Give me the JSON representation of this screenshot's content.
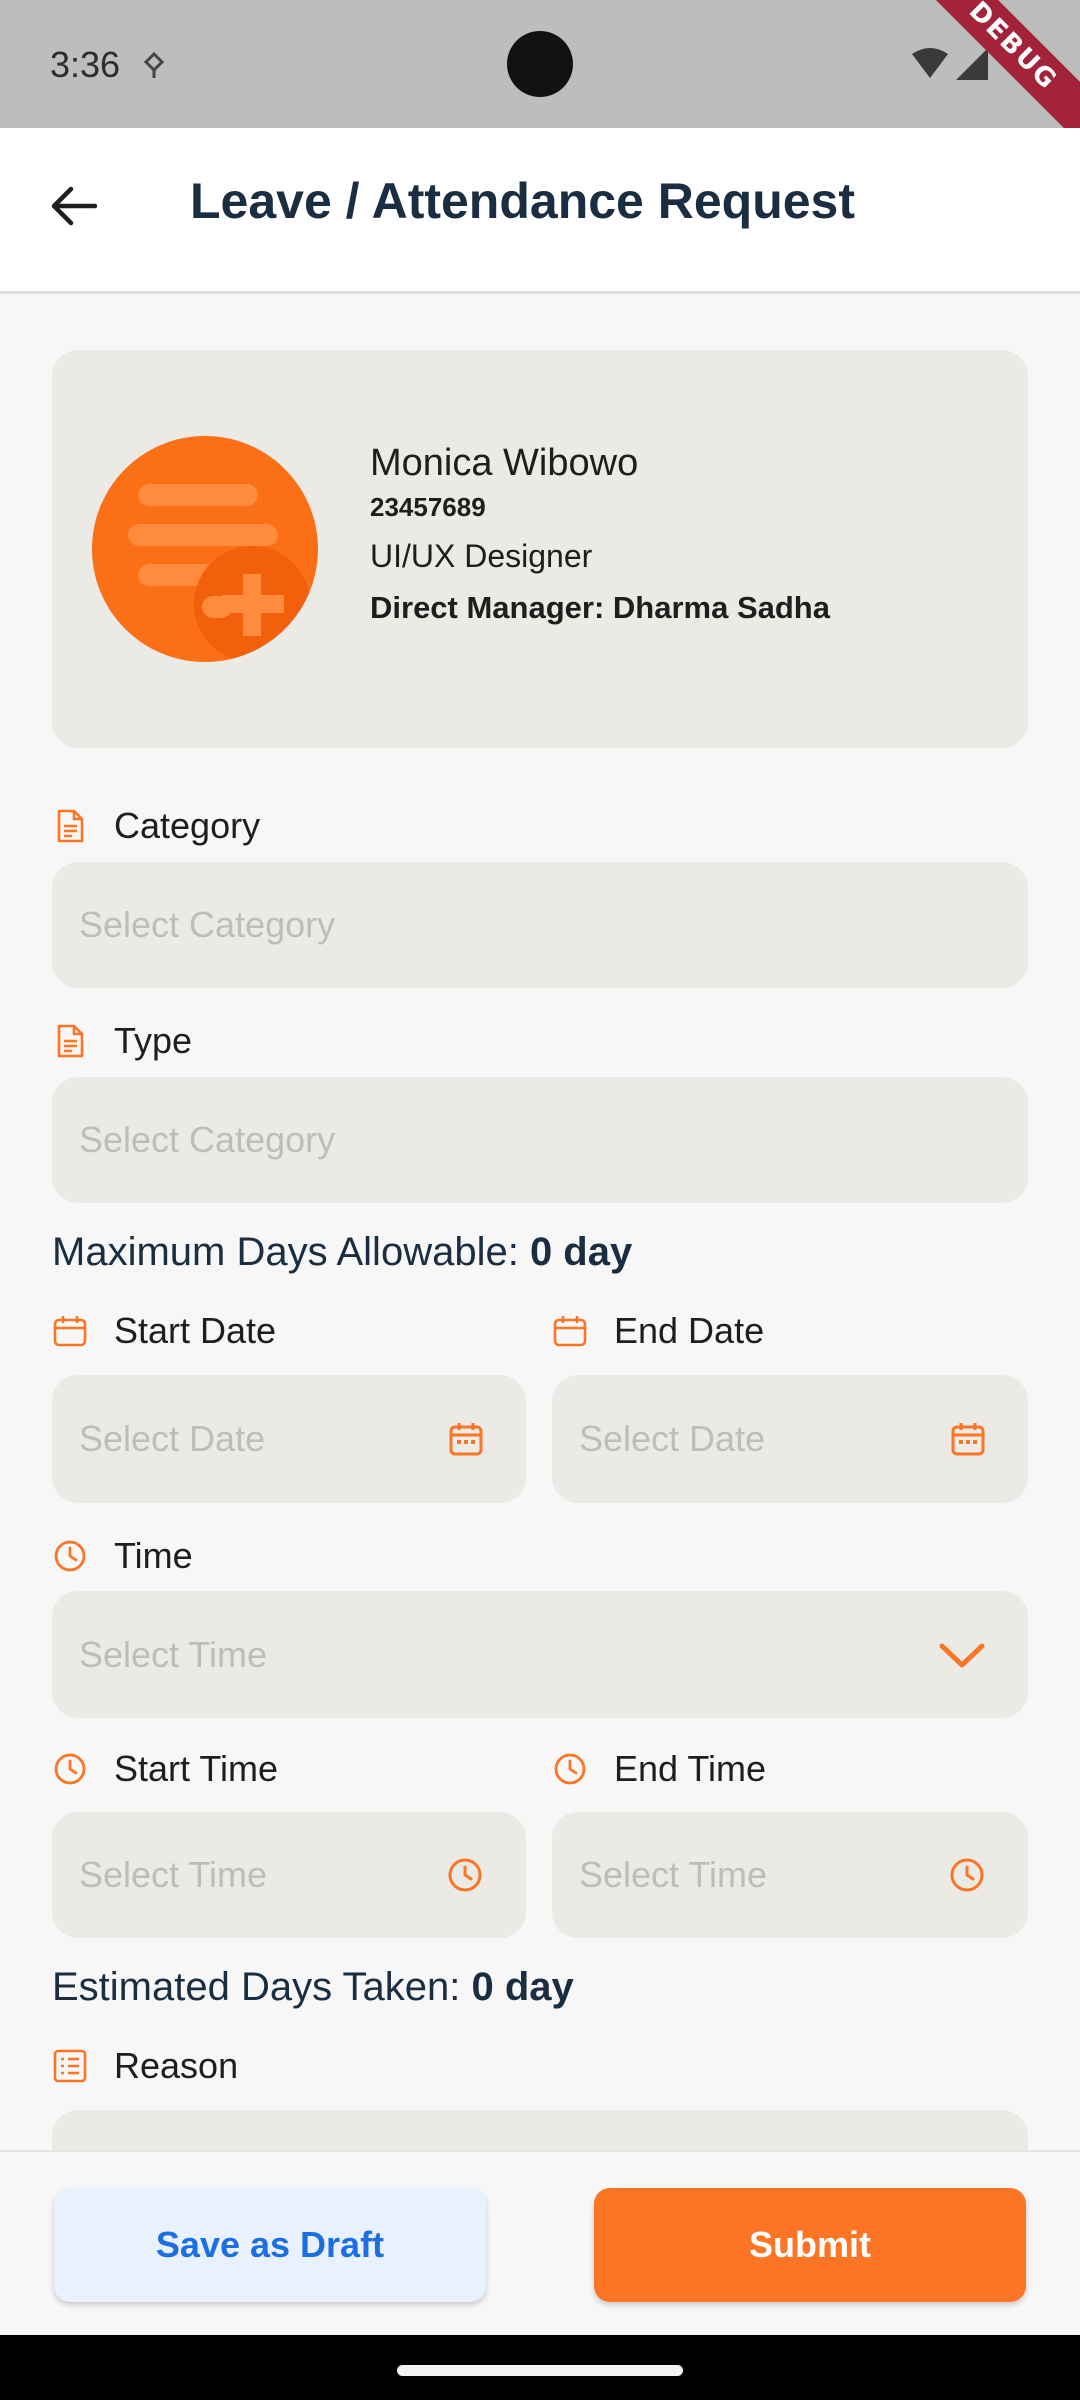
{
  "status_bar": {
    "time": "3:36",
    "debug_label": "DEBUG"
  },
  "app_bar": {
    "title": "Leave / Attendance Request"
  },
  "profile": {
    "name": "Monica Wibowo",
    "employee_id": "23457689",
    "role": "UI/UX Designer",
    "manager": "Direct Manager: Dharma Sadha"
  },
  "form": {
    "category": {
      "label": "Category",
      "placeholder": "Select Category"
    },
    "type": {
      "label": "Type",
      "placeholder": "Select Category"
    },
    "max_days": {
      "prefix": "Maximum Days Allowable: ",
      "value": "0 day"
    },
    "start_date": {
      "label": "Start Date",
      "placeholder": "Select Date"
    },
    "end_date": {
      "label": "End Date",
      "placeholder": "Select Date"
    },
    "time": {
      "label": "Time",
      "placeholder": "Select Time"
    },
    "start_time": {
      "label": "Start Time",
      "placeholder": "Select Time"
    },
    "end_time": {
      "label": "End Time",
      "placeholder": "Select Time"
    },
    "estimated": {
      "prefix": "Estimated Days Taken: ",
      "value": "0 day"
    },
    "reason": {
      "label": "Reason"
    }
  },
  "actions": {
    "draft_label": "Save as Draft",
    "submit_label": "Submit"
  },
  "colors": {
    "accent": "#fb7524",
    "primary_text": "#1b2d40",
    "field_bg": "#ebeae5",
    "draft_text": "#1d6fe0"
  }
}
